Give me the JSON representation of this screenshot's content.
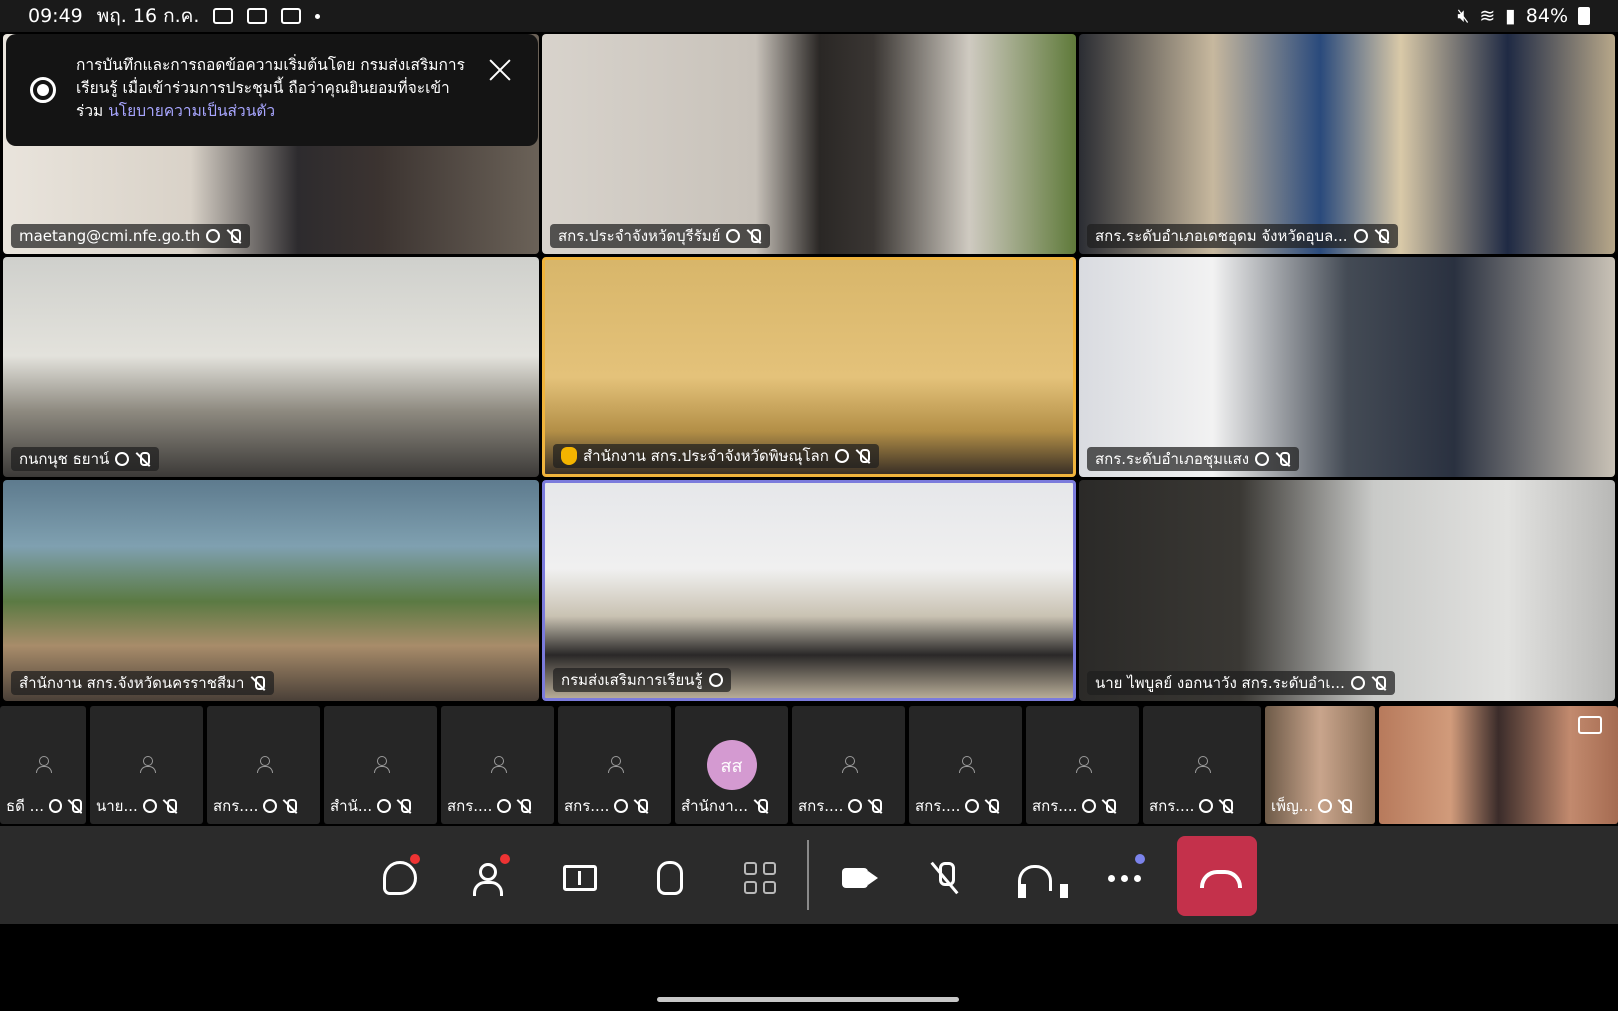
{
  "status_bar": {
    "time": "09:49",
    "date": "พฤ. 16 ก.ค.",
    "battery": "84%"
  },
  "recording_banner": {
    "text": "การบันทึกและการถอดข้อความเริ่มต้นโดย กรมส่งเสริมการเรียนรู้ เมื่อเข้าร่วมการประชุมนี้ ถือว่าคุณยินยอมที่จะเข้าร่วม",
    "link": "นโยบายความเป็นส่วนตัว"
  },
  "video_tiles": [
    {
      "name": "maetang@cmi.nfe.go.th"
    },
    {
      "name": "สกร.ประจำจังหวัดบุรีรัมย์"
    },
    {
      "name": "สกร.ระดับอำเภอเดชอุดม จังหวัดอุบล..."
    },
    {
      "name": "กนกนุช ธยาน์"
    },
    {
      "name": "สำนักงาน สกร.ประจำจังหวัดพิษณุโลก"
    },
    {
      "name": "สกร.ระดับอำเภอชุมแสง"
    },
    {
      "name": "สำนักงาน สกร.จังหวัดนครราชสีมา"
    },
    {
      "name": "กรมส่งเสริมการเรียนรู้"
    },
    {
      "name": "นาย ไพบูลย์ งอกนาวัง สกร.ระดับอำเ..."
    }
  ],
  "participants": [
    {
      "name": "ธดี ..."
    },
    {
      "name": "นาย..."
    },
    {
      "name": "สกร...."
    },
    {
      "name": "สำนั..."
    },
    {
      "name": "สกร...."
    },
    {
      "name": "สกร...."
    },
    {
      "name": "สำนักงา...",
      "initials": "สส"
    },
    {
      "name": "สกร...."
    },
    {
      "name": "สกร...."
    },
    {
      "name": "สกร...."
    },
    {
      "name": "สกร...."
    },
    {
      "name": "เพ็ญ..."
    }
  ],
  "controls": [
    "chat",
    "people",
    "share",
    "react",
    "layout",
    "camera",
    "mute",
    "audio",
    "more",
    "leave"
  ],
  "colors": {
    "hangup": "#c4314b",
    "active_speaker": "#7b7bdc",
    "raised_hand": "#f0b43c"
  }
}
